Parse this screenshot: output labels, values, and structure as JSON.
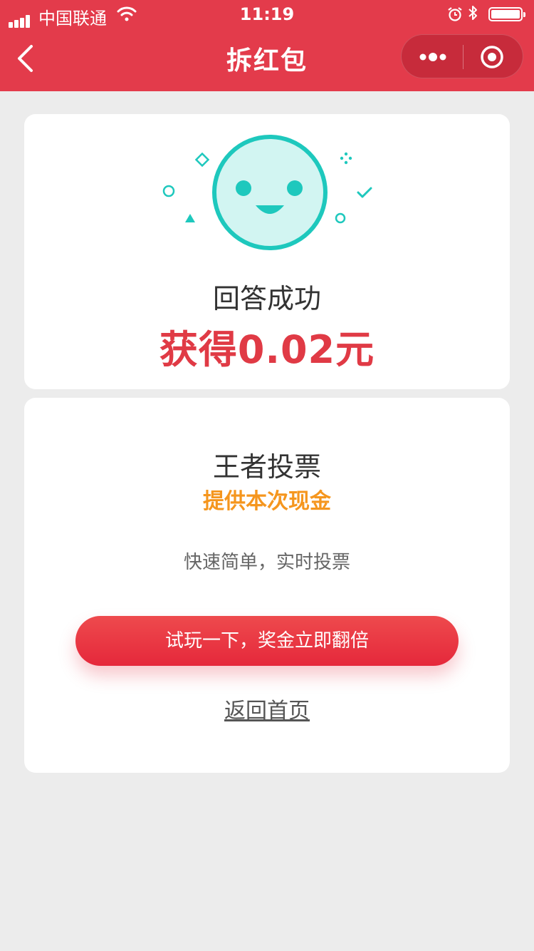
{
  "status_bar": {
    "carrier": "中国联通",
    "time": "11:19",
    "icons": [
      "signal-icon",
      "wifi-icon",
      "alarm-icon",
      "bluetooth-icon",
      "battery-icon"
    ]
  },
  "nav": {
    "title": "拆红包",
    "back_icon": "chevron-left-icon",
    "more_icon": "more-icon",
    "close_icon": "target-icon"
  },
  "result": {
    "face_icon": "smiley-face-icon",
    "answer_text": "回答成功",
    "earned_text": "获得0.02元"
  },
  "promo": {
    "title": "王者投票",
    "subtitle": "提供本次现金",
    "description": "快速简单，实时投票",
    "cta_label": "试玩一下，奖金立即翻倍",
    "home_link": "返回首页"
  },
  "colors": {
    "brand_red": "#e33b4b",
    "accent_orange": "#f5961e",
    "face_teal": "#1ec8bd",
    "face_fill": "#d2f5f2"
  }
}
